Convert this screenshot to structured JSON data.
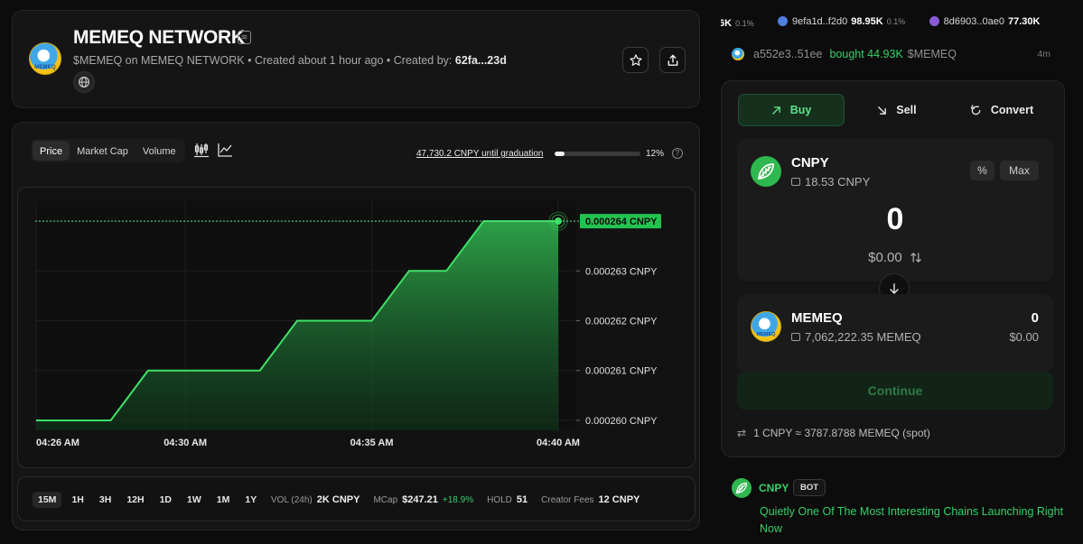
{
  "header": {
    "title": "MEMEQ NETWORK",
    "logo_text": "MEMEQ",
    "ticker_symbol": "$MEMEQ",
    "network_text": "on MEMEQ NETWORK",
    "created_text": "• Created about 1 hour ago • Created by:",
    "creator": "62fa...23d"
  },
  "chart_controls": {
    "metric_tabs": [
      "Price",
      "Market Cap",
      "Volume"
    ],
    "active_metric": "Price",
    "graduation_text": "47,730.2 CNPY until graduation",
    "graduation_progress": 0.12,
    "graduation_pct": "12%"
  },
  "chart_data": {
    "type": "line",
    "x": [
      "04:26",
      "04:27",
      "04:28",
      "04:29",
      "04:30",
      "04:31",
      "04:32",
      "04:33",
      "04:34",
      "04:35",
      "04:36",
      "04:37",
      "04:38",
      "04:39",
      "04:40"
    ],
    "y": [
      0.00026,
      0.00026,
      0.00026,
      0.000261,
      0.000261,
      0.000261,
      0.000261,
      0.000262,
      0.000262,
      0.000262,
      0.000263,
      0.000263,
      0.000264,
      0.000264,
      0.000264
    ],
    "x_tick_labels": [
      "04:26 AM",
      "04:30 AM",
      "04:35 AM",
      "04:40 AM"
    ],
    "y_tick_labels": [
      "0.000264 CNPY",
      "0.000263 CNPY",
      "0.000262 CNPY",
      "0.000261 CNPY",
      "0.000260 CNPY"
    ],
    "current_label": "0.000264 CNPY",
    "ylim": [
      0.0002598,
      0.0002644
    ],
    "grid": true,
    "line_color": "#3fe067"
  },
  "timeframes": [
    "15M",
    "1H",
    "3H",
    "12H",
    "1D",
    "1W",
    "1M",
    "1Y"
  ],
  "active_timeframe": "15M",
  "stats": {
    "vol_label": "VOL (24h)",
    "vol_value": "2K CNPY",
    "mcap_label": "MCap",
    "mcap_value": "$247.21",
    "mcap_change": "+18.9%",
    "hold_label": "HOLD",
    "hold_value": "51",
    "fees_label": "Creator Fees",
    "fees_value": "12 CNPY"
  },
  "ticker": [
    {
      "name": "",
      "value": "6K",
      "pct": "0.1%",
      "color": "#4a4a4a"
    },
    {
      "name": "9efa1d..f2d0",
      "value": "98.95K",
      "pct": "0.1%",
      "color": "#4f7de0"
    },
    {
      "name": "8d6903..0ae0",
      "value": "77.30K",
      "pct": "0.1%",
      "color": "#8a5bd6"
    }
  ],
  "recent_trade": {
    "address": "a552e3..51ee",
    "action": "bought 44.93K",
    "token": "$MEMEQ",
    "time": "4m"
  },
  "swap": {
    "tabs": [
      "Buy",
      "Sell",
      "Convert"
    ],
    "active_tab": "Buy",
    "from_symbol": "CNPY",
    "from_balance": "18.53 CNPY",
    "pct_label": "%",
    "max_label": "Max",
    "amount": "0",
    "usd_value": "$0.00",
    "to_symbol": "MEMEQ",
    "to_logo_text": "MEMEQ",
    "to_balance": "7,062,222.35 MEMEQ",
    "to_amount": "0",
    "to_usd": "$0.00",
    "continue_label": "Continue",
    "rate": "1 CNPY ≈ 3787.8788 MEMEQ (spot)"
  },
  "feed": {
    "author": "CNPY",
    "badge": "BOT",
    "text": "Quietly One Of The Most Interesting Chains Launching Right Now"
  }
}
